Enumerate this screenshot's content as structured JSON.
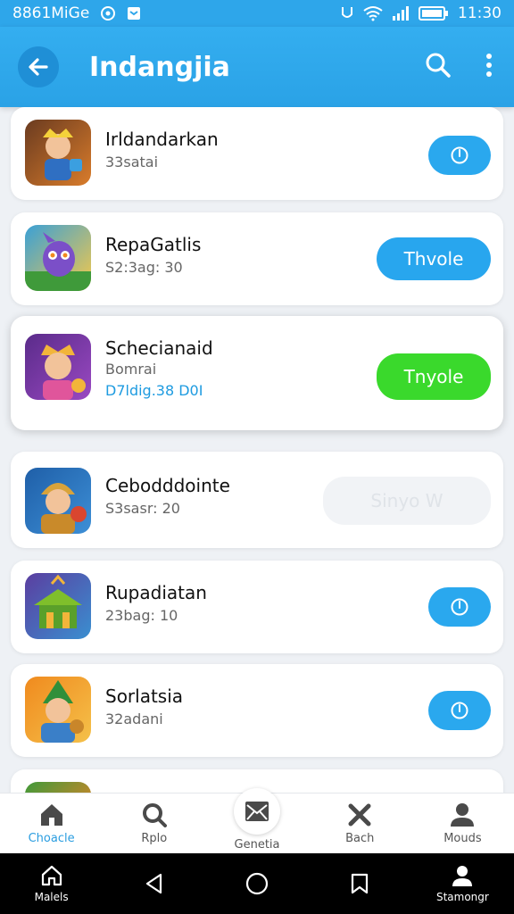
{
  "status_bar": {
    "left_text": "8861MiGe",
    "time": "11:30",
    "icons": [
      "camera-icon",
      "message-icon",
      "signal-icon",
      "wifi-icon",
      "cell-icon",
      "battery-icon"
    ]
  },
  "app_bar": {
    "title": "Indangjia",
    "back_icon": "arrow-left-icon",
    "search_icon": "search-icon",
    "menu_icon": "more-vert-icon"
  },
  "list": {
    "items": [
      {
        "name": "Irldandarkan",
        "sub": "33satai",
        "extra": "",
        "action_type": "icon",
        "action_label": "",
        "icon": "warrior-game-icon",
        "colors": [
          "#6a3b20",
          "#d97c2b"
        ]
      },
      {
        "name": "RepaGatlis",
        "sub": "S2:3ag: 30",
        "extra": "",
        "action_type": "wide",
        "action_label": "Thvole",
        "icon": "purple-creature-game-icon",
        "colors": [
          "#3aa0d6",
          "#f7c948"
        ]
      },
      {
        "name": "Schecianaid",
        "sub": "Bomrai",
        "extra": "D7ldig.38 D0I",
        "action_type": "green",
        "action_label": "Tnyole",
        "icon": "king-game-icon",
        "colors": [
          "#5a2b8a",
          "#f2b53a"
        ]
      },
      {
        "name": "Cebodddointe",
        "sub": "S3sasr: 20",
        "extra": "",
        "action_type": "disabled",
        "action_label": "Sinyo W",
        "icon": "knight-game-icon",
        "colors": [
          "#1f5fa8",
          "#d9a33a"
        ]
      },
      {
        "name": "Rupadiatan",
        "sub": "23bag: 10",
        "extra": "",
        "action_type": "icon",
        "action_label": "",
        "icon": "temple-game-icon",
        "colors": [
          "#5b3ea0",
          "#7fbf2b"
        ]
      },
      {
        "name": "Sorlatsia",
        "sub": "32adani",
        "extra": "",
        "action_type": "icon",
        "action_label": "",
        "icon": "elf-game-icon",
        "colors": [
          "#f08a1e",
          "#2f8f3a"
        ]
      }
    ]
  },
  "bottom_nav": {
    "items": [
      {
        "label": "Choacle",
        "icon": "home-icon",
        "active": true
      },
      {
        "label": "Rplo",
        "icon": "search-icon",
        "active": false
      },
      {
        "label": "Genetia",
        "icon": "mail-icon",
        "active": false
      },
      {
        "label": "Bach",
        "icon": "tools-icon",
        "active": false
      },
      {
        "label": "Mouds",
        "icon": "person-icon",
        "active": false
      }
    ]
  },
  "system_nav": {
    "items": [
      {
        "label": "Malels",
        "icon": "home-outline-icon"
      },
      {
        "label": "",
        "icon": "back-triangle-icon"
      },
      {
        "label": "",
        "icon": "home-circle-icon"
      },
      {
        "label": "",
        "icon": "recents-icon"
      },
      {
        "label": "Stamongr",
        "icon": "person-icon"
      }
    ]
  },
  "colors": {
    "primary": "#2ea6ea",
    "green": "#3ad92c",
    "disabled": "#f1f3f6"
  }
}
